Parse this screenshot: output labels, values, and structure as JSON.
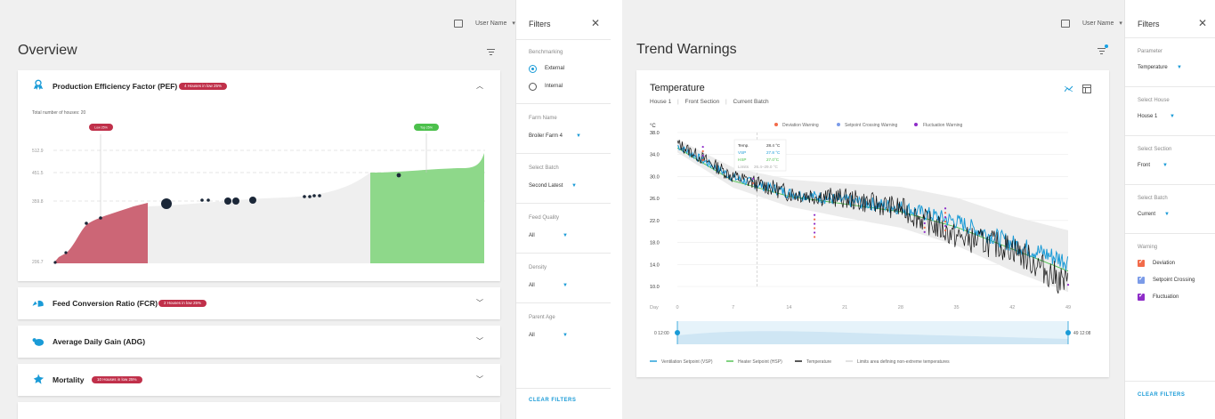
{
  "left": {
    "header": {
      "user_name": "User Name"
    },
    "page_title": "Overview",
    "filters": {
      "title": "Filters",
      "benchmarking_label": "Benchmarking",
      "bench_options": [
        "External",
        "Internal"
      ],
      "farm_label": "Farm Name",
      "farm_value": "Broiler Farm 4",
      "batch_label": "Select Batch",
      "batch_value": "Second Latest",
      "feed_label": "Feed Quality",
      "feed_value": "All",
      "density_label": "Density",
      "density_value": "All",
      "parent_label": "Parent Age",
      "parent_value": "All",
      "clear": "CLEAR FILTERS"
    },
    "pef": {
      "title": "Production Efficiency Factor (PEF)",
      "badge": "4 Houses in low 25%",
      "total_houses": "Total number of houses: 20",
      "low_flag": "Low 25%",
      "top_flag": "Top 25%",
      "y_ticks": [
        "512.9",
        "451.5",
        "359.8",
        "206.7"
      ]
    },
    "cards": [
      {
        "title": "Feed Conversion Ratio (FCR)",
        "badge": "2 Houses in low 25%"
      },
      {
        "title": "Average Daily Gain (ADG)",
        "badge": ""
      },
      {
        "title": "Mortality",
        "badge": "10 Houses in low 25%"
      }
    ]
  },
  "right": {
    "header": {
      "user_name": "User Name"
    },
    "page_title": "Trend Warnings",
    "filters": {
      "title": "Filters",
      "param_label": "Parameter",
      "param_value": "Temperature",
      "house_label": "Select House",
      "house_value": "House 1",
      "section_label": "Select Section",
      "section_value": "Front",
      "batch_label": "Select Batch",
      "batch_value": "Current",
      "warning_label": "Warning",
      "warnings": [
        "Deviation",
        "Setpoint Crossing",
        "Fluctuation"
      ],
      "clear": "CLEAR FILTERS"
    },
    "card": {
      "title": "Temperature",
      "breadcrumb": [
        "House 1",
        "Front Section",
        "Current Batch"
      ],
      "unit": "°C",
      "x_label": "Day",
      "range_start": "0 12:00",
      "range_end": "49 12:08"
    },
    "tooltip": {
      "rows": [
        {
          "label": "Temp.",
          "value": "28.4 °C"
        },
        {
          "label": "VSP",
          "value": "27.8 °C"
        },
        {
          "label": "HSP",
          "value": "27.0°C"
        },
        {
          "label": "Limits",
          "value": "26.4–29.0 °C"
        }
      ]
    },
    "colors": {
      "deviation": "#f26b4a",
      "setpoint": "#7b9be8",
      "fluctuation": "#8e2cc8",
      "vsp": "#1a9bd7",
      "hsp": "#4cc04c"
    },
    "chart_data": {
      "type": "line",
      "ylabel": "°C",
      "xlabel": "Day",
      "y_ticks": [
        "38.0",
        "34.0",
        "30.0",
        "26.0",
        "22.0",
        "18.0",
        "14.0",
        "10.0"
      ],
      "x_ticks": [
        "0",
        "7",
        "14",
        "21",
        "28",
        "35",
        "42",
        "49"
      ],
      "ylim": [
        10,
        38
      ],
      "xlim": [
        0,
        49
      ],
      "legend_top": [
        "Deviation Warning",
        "Setpoint Crossing Warning",
        "Fluctuation Warning"
      ],
      "legend_bottom": [
        "Ventilation Setpoint (VSP)",
        "Heater Setpoint (HSP)",
        "Temperature",
        "Limits area defining non-extreme temperatures"
      ],
      "series": [
        {
          "name": "Ventilation Setpoint (VSP)",
          "x": [
            0,
            7,
            14,
            21,
            28,
            35,
            42,
            49
          ],
          "values": [
            35.6,
            29.8,
            27.0,
            25.6,
            24.4,
            21.8,
            17.8,
            14.6
          ]
        },
        {
          "name": "Heater Setpoint (HSP)",
          "x": [
            0,
            7,
            14,
            21,
            28,
            35,
            42,
            49
          ],
          "values": [
            35.2,
            29.2,
            26.4,
            25.0,
            23.6,
            20.8,
            16.8,
            12.8
          ]
        },
        {
          "name": "Temperature",
          "x": [
            0,
            7,
            14,
            21,
            28,
            35,
            42,
            49
          ],
          "values": [
            36.0,
            30.0,
            27.0,
            26.0,
            24.2,
            19.0,
            17.0,
            10.2
          ]
        }
      ]
    }
  }
}
